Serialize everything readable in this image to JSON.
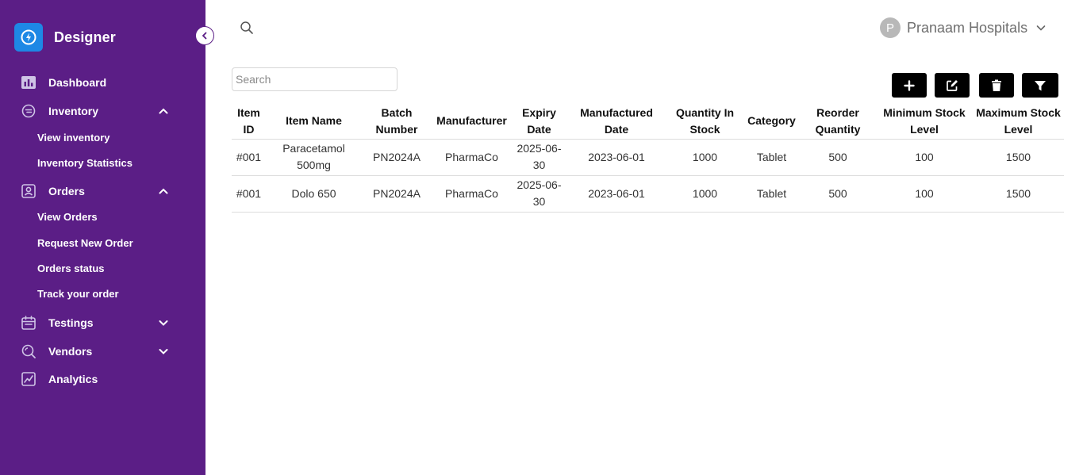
{
  "app": {
    "name": "Designer"
  },
  "account": {
    "initial": "P",
    "name": "Pranaam Hospitals"
  },
  "sidebar": {
    "items": [
      {
        "label": "Dashboard",
        "icon": "chart-bar-icon"
      },
      {
        "label": "Inventory",
        "icon": "inventory-icon",
        "expanded": true,
        "children": [
          {
            "label": "View inventory"
          },
          {
            "label": "Inventory Statistics"
          }
        ]
      },
      {
        "label": "Orders",
        "icon": "orders-icon",
        "expanded": true,
        "children": [
          {
            "label": "View Orders"
          },
          {
            "label": "Request New Order"
          },
          {
            "label": "Orders status"
          },
          {
            "label": "Track your order"
          }
        ]
      },
      {
        "label": "Testings",
        "icon": "calendar-icon",
        "expanded": false
      },
      {
        "label": "Vendors",
        "icon": "search-icon",
        "expanded": false
      },
      {
        "label": "Analytics",
        "icon": "analytics-icon"
      }
    ]
  },
  "search": {
    "placeholder": "Search",
    "value": ""
  },
  "toolbar": {
    "buttons": [
      "add-icon",
      "edit-icon",
      "trash-icon",
      "filter-icon"
    ]
  },
  "table": {
    "headers": [
      "Item ID",
      "Item Name",
      "Batch Number",
      "Manufacturer",
      "Expiry Date",
      "Manufactured Date",
      "Quantity In Stock",
      "Category",
      "Reorder Quantity",
      "Minimum Stock Level",
      "Maximum Stock Level"
    ],
    "rows": [
      [
        "#001",
        "Paracetamol 500mg",
        "PN2024A",
        "PharmaCo",
        "2025-06-30",
        "2023-06-01",
        "1000",
        "Tablet",
        "500",
        "100",
        "1500"
      ],
      [
        "#001",
        "Dolo 650",
        "PN2024A",
        "PharmaCo",
        "2025-06-30",
        "2023-06-01",
        "1000",
        "Tablet",
        "500",
        "100",
        "1500"
      ]
    ]
  },
  "colors": {
    "sidebar": "#5b1e86",
    "brand": "#1e88e5",
    "button": "#000000"
  }
}
